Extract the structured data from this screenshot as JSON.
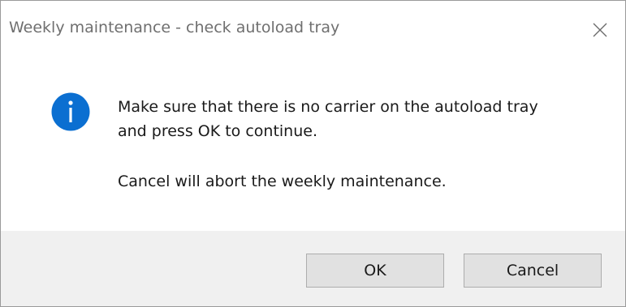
{
  "window": {
    "title": "Weekly maintenance - check autoload tray",
    "close_icon": "close-icon"
  },
  "message": {
    "icon": "info-icon",
    "icon_color": "#0b6fd1",
    "line1": "Make sure that there is no carrier on the autoload tray",
    "line2": "and press OK to continue.",
    "line3": "Cancel will abort the weekly maintenance."
  },
  "buttons": {
    "ok_label": "OK",
    "cancel_label": "Cancel"
  }
}
